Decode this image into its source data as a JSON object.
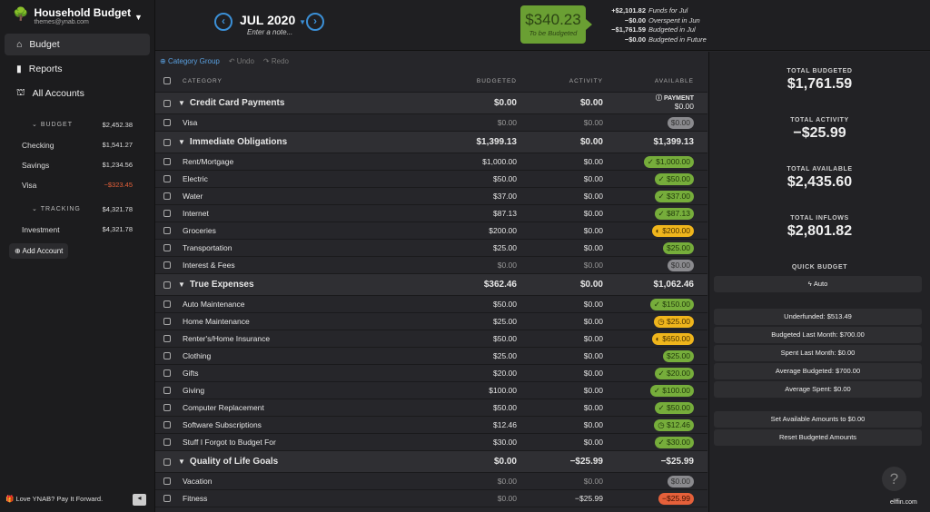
{
  "sidebar": {
    "budget_name": "Household Budget",
    "email": "themes@ynab.com",
    "nav": [
      {
        "label": "Budget",
        "icon": "bank-icon"
      },
      {
        "label": "Reports",
        "icon": "bar-chart-icon"
      },
      {
        "label": "All Accounts",
        "icon": "columns-icon"
      }
    ],
    "budget_section": {
      "label": "BUDGET",
      "total": "$2,452.38",
      "accounts": [
        {
          "name": "Checking",
          "balance": "$1,541.27"
        },
        {
          "name": "Savings",
          "balance": "$1,234.56"
        },
        {
          "name": "Visa",
          "balance": "−$323.45",
          "negative": true
        }
      ]
    },
    "tracking_section": {
      "label": "TRACKING",
      "total": "$4,321.78",
      "accounts": [
        {
          "name": "Investment",
          "balance": "$4,321.78"
        }
      ]
    },
    "add_account": "Add Account",
    "footer": "Love YNAB? Pay It Forward."
  },
  "header": {
    "month": "JUL 2020",
    "note_placeholder": "Enter a note...",
    "to_be_budgeted": "$340.23",
    "tbb_label": "To be Budgeted",
    "funds": [
      {
        "amount": "+$2,101.82",
        "label": "Funds for Jul"
      },
      {
        "amount": "−$0.00",
        "label": "Overspent in Jun"
      },
      {
        "amount": "−$1,761.59",
        "label": "Budgeted in Jul"
      },
      {
        "amount": "−$0.00",
        "label": "Budgeted in Future"
      }
    ]
  },
  "toolbar": {
    "category_group": "Category Group",
    "undo": "Undo",
    "redo": "Redo"
  },
  "table": {
    "columns": [
      "CATEGORY",
      "BUDGETED",
      "ACTIVITY",
      "AVAILABLE"
    ],
    "rows": [
      {
        "group": true,
        "name": "Credit Card Payments",
        "budgeted": "$0.00",
        "activity": "$0.00",
        "available": "$0.00",
        "payment_label": "PAYMENT"
      },
      {
        "name": "Visa",
        "budgeted": "$0.00",
        "activity": "$0.00",
        "available": "$0.00",
        "pill": "gray"
      },
      {
        "group": true,
        "name": "Immediate Obligations",
        "budgeted": "$1,399.13",
        "activity": "$0.00",
        "available": "$1,399.13"
      },
      {
        "name": "Rent/Mortgage",
        "budgeted": "$1,000.00",
        "activity": "$0.00",
        "available": "$1,000.00",
        "pill": "green",
        "icon": "check"
      },
      {
        "name": "Electric",
        "budgeted": "$50.00",
        "activity": "$0.00",
        "available": "$50.00",
        "pill": "green",
        "icon": "check"
      },
      {
        "name": "Water",
        "budgeted": "$37.00",
        "activity": "$0.00",
        "available": "$37.00",
        "pill": "green",
        "icon": "check"
      },
      {
        "name": "Internet",
        "budgeted": "$87.13",
        "activity": "$0.00",
        "available": "$87.13",
        "pill": "green",
        "icon": "check"
      },
      {
        "name": "Groceries",
        "budgeted": "$200.00",
        "activity": "$0.00",
        "available": "$200.00",
        "pill": "yellow",
        "icon": "half"
      },
      {
        "name": "Transportation",
        "budgeted": "$25.00",
        "activity": "$0.00",
        "available": "$25.00",
        "pill": "green"
      },
      {
        "name": "Interest & Fees",
        "budgeted": "$0.00",
        "activity": "$0.00",
        "available": "$0.00",
        "pill": "gray"
      },
      {
        "group": true,
        "name": "True Expenses",
        "budgeted": "$362.46",
        "activity": "$0.00",
        "available": "$1,062.46"
      },
      {
        "name": "Auto Maintenance",
        "budgeted": "$50.00",
        "activity": "$0.00",
        "available": "$150.00",
        "pill": "green",
        "icon": "check"
      },
      {
        "name": "Home Maintenance",
        "budgeted": "$25.00",
        "activity": "$0.00",
        "available": "$25.00",
        "pill": "yellow",
        "icon": "clock"
      },
      {
        "name": "Renter's/Home Insurance",
        "budgeted": "$50.00",
        "activity": "$0.00",
        "available": "$650.00",
        "pill": "yellow",
        "icon": "half"
      },
      {
        "name": "Clothing",
        "budgeted": "$25.00",
        "activity": "$0.00",
        "available": "$25.00",
        "pill": "green"
      },
      {
        "name": "Gifts",
        "budgeted": "$20.00",
        "activity": "$0.00",
        "available": "$20.00",
        "pill": "green",
        "icon": "check"
      },
      {
        "name": "Giving",
        "budgeted": "$100.00",
        "activity": "$0.00",
        "available": "$100.00",
        "pill": "green",
        "icon": "check"
      },
      {
        "name": "Computer Replacement",
        "budgeted": "$50.00",
        "activity": "$0.00",
        "available": "$50.00",
        "pill": "green",
        "icon": "check"
      },
      {
        "name": "Software Subscriptions",
        "budgeted": "$12.46",
        "activity": "$0.00",
        "available": "$12.46",
        "pill": "green",
        "icon": "clock"
      },
      {
        "name": "Stuff I Forgot to Budget For",
        "budgeted": "$30.00",
        "activity": "$0.00",
        "available": "$30.00",
        "pill": "green",
        "icon": "check"
      },
      {
        "group": true,
        "name": "Quality of Life Goals",
        "budgeted": "$0.00",
        "activity": "−$25.99",
        "available": "−$25.99"
      },
      {
        "name": "Vacation",
        "budgeted": "$0.00",
        "activity": "$0.00",
        "available": "$0.00",
        "pill": "gray"
      },
      {
        "name": "Fitness",
        "budgeted": "$0.00",
        "activity": "−$25.99",
        "available": "−$25.99",
        "pill": "red"
      }
    ]
  },
  "inspector": {
    "totals": [
      {
        "label": "TOTAL BUDGETED",
        "value": "$1,761.59"
      },
      {
        "label": "TOTAL ACTIVITY",
        "value": "−$25.99"
      },
      {
        "label": "TOTAL AVAILABLE",
        "value": "$2,435.60"
      },
      {
        "label": "TOTAL INFLOWS",
        "value": "$2,801.82"
      }
    ],
    "quick_budget_label": "QUICK BUDGET",
    "auto": "Auto",
    "quick": [
      "Underfunded: $513.49",
      "Budgeted Last Month: $700.00",
      "Spent Last Month: $0.00",
      "Average Budgeted: $700.00",
      "Average Spent: $0.00"
    ],
    "actions": [
      "Set Available Amounts to $0.00",
      "Reset Budgeted Amounts"
    ],
    "help": "?"
  },
  "watermark": "elffin.com",
  "colors": {
    "green": "#76ad3b",
    "yellow": "#efb51c",
    "red": "#e5603a",
    "blue": "#3b8fd6"
  }
}
